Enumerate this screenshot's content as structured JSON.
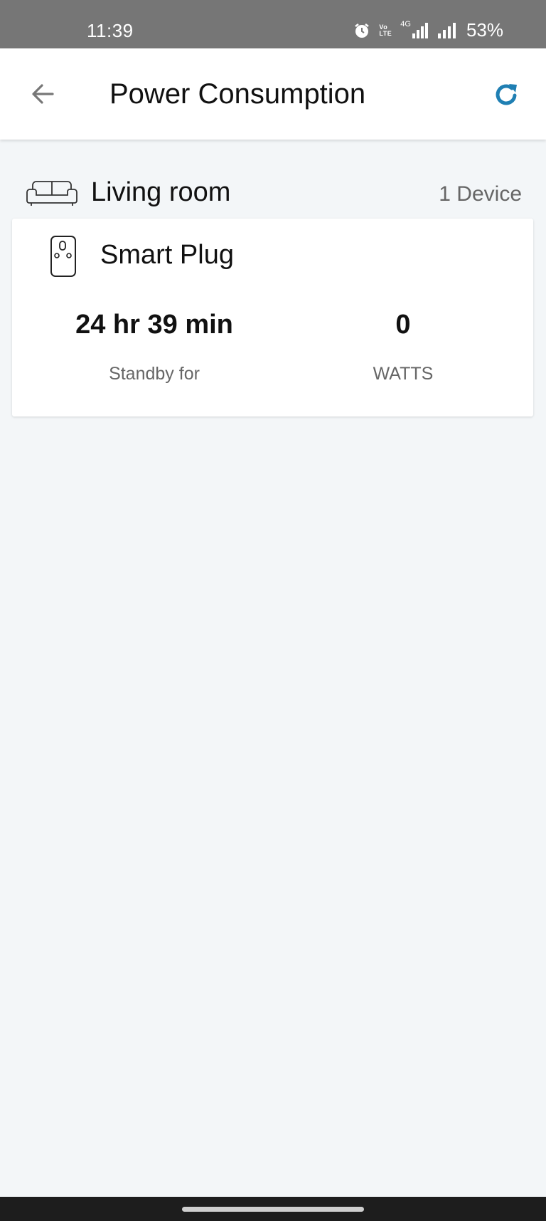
{
  "status_bar": {
    "time": "11:39",
    "network_label_top": "Vo",
    "network_label_bottom": "LTE",
    "network_type": "4G",
    "battery": "53%"
  },
  "app_bar": {
    "title": "Power Consumption",
    "back_icon": "arrow-left-icon",
    "refresh_icon": "refresh-icon",
    "accent_color": "#1f7fb3"
  },
  "room": {
    "name": "Living room",
    "device_count": "1 Device",
    "icon": "sofa-icon"
  },
  "devices": [
    {
      "name": "Smart Plug",
      "icon": "smart-plug-icon",
      "standby_value": "24 hr 39 min",
      "standby_label": "Standby for",
      "watts_value": "0",
      "watts_label": "WATTS"
    }
  ]
}
